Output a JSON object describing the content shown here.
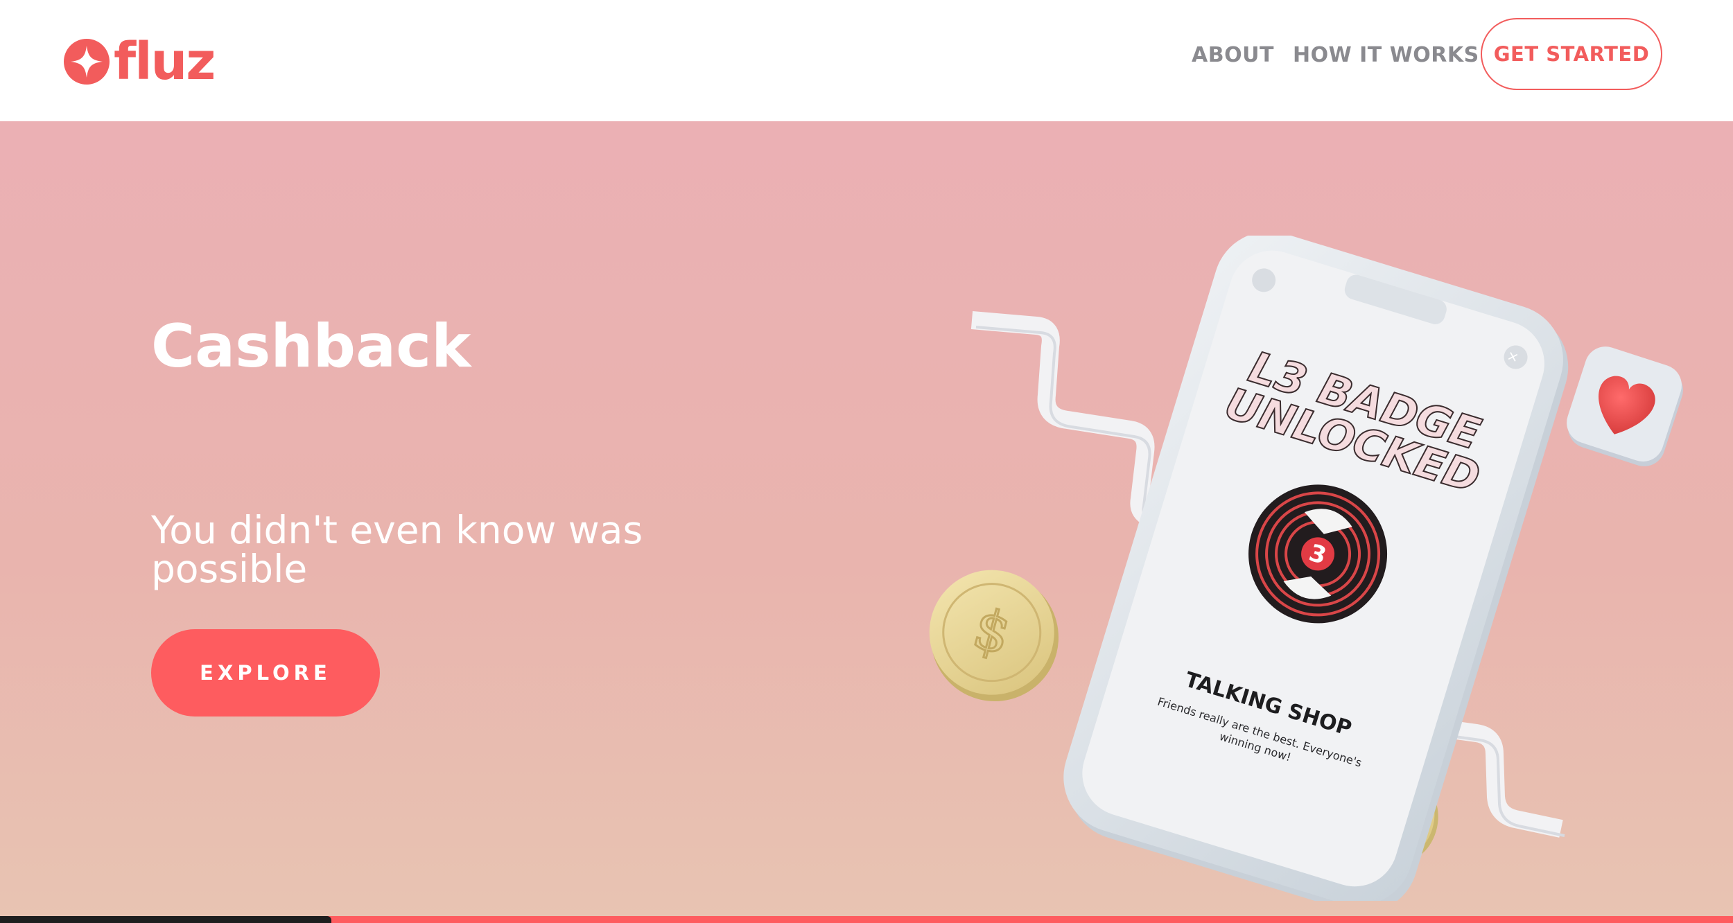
{
  "brand": {
    "name": "fluz",
    "accent": "#fe5c5f",
    "icon": "sparkle-star-icon"
  },
  "nav": {
    "about": "ABOUT",
    "how_it_works": "HOW IT WORKS",
    "get_started": "GET STARTED"
  },
  "hero": {
    "title": "Cashback",
    "subtitle": "You didn't even know was possible",
    "explore": "EXPLORE"
  },
  "phone": {
    "badge_line1": "L3 BADGE",
    "badge_line2": "UNLOCKED",
    "badge_number": "3",
    "card_title": "TALKING SHOP",
    "card_text_line1": "Friends really are the best. Everyone's",
    "card_text_line2": "winning now!"
  },
  "decor": {
    "coin_symbol": "$",
    "heart": "heart-icon"
  }
}
